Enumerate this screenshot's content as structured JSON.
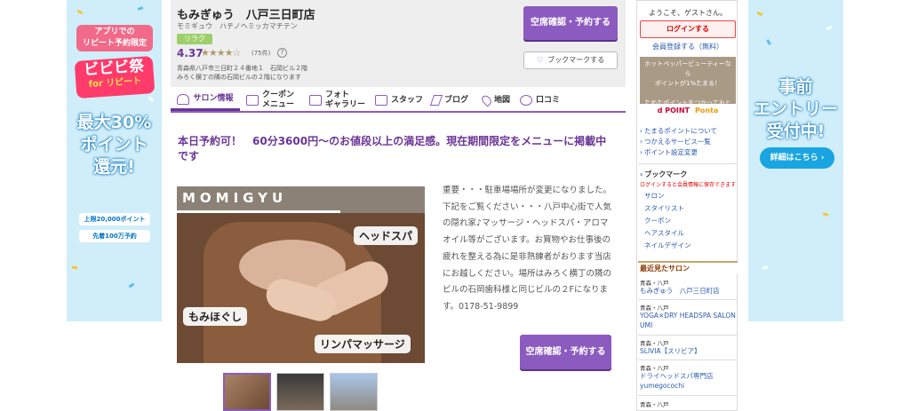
{
  "left_banner": {
    "pill": "アプリでの\nリピート予約限定",
    "logo_main": "ビビビ祭",
    "logo_sub": "for リピート",
    "headline_1": "最大30%",
    "headline_2": "ポイント",
    "headline_3": "還元!",
    "sub_1": "上限20,000ポイント",
    "sub_2": "先着100万予約"
  },
  "right_banner": {
    "headline_1": "事前",
    "headline_2": "エントリー",
    "headline_3": "受付中!",
    "button": "詳細はこちら ›"
  },
  "salon": {
    "name": "もみぎゅう　八戸三日町店",
    "kana": "モミギュウ　ハチノヘミッカマチテン",
    "category": "リラク",
    "rating": "4.37",
    "stars": "★★★★☆",
    "review_count": "(75件)",
    "help": "?",
    "address_1": "青森県八戸市三日町２４番地１　石岡ビル２階",
    "address_2": "みろく横丁の隣の石岡ビルの２階になります",
    "reserve_label": "空席確認・予約する",
    "bookmark_label": "ブックマークする"
  },
  "tabs": [
    {
      "label": "サロン情報"
    },
    {
      "label": "クーポン\nメニュー"
    },
    {
      "label": "フォト\nギャラリー"
    },
    {
      "label": "スタッフ"
    },
    {
      "label": "ブログ"
    },
    {
      "label": "地図"
    },
    {
      "label": "口コミ"
    }
  ],
  "main": {
    "catch_copy": "本日予約可！　60分3600円〜のお値段以上の満足感。現在期間限定をメニューに掲載中です",
    "photo_brand": "MOMIGYU",
    "photo_label_1": "ヘッドスパ",
    "photo_label_2": "もみほぐし",
    "photo_label_3": "リンパマッサージ",
    "description": "重要・・・駐車場場所が変更になりました。下記をご覧ください・・・八戸中心街で人気の隠れ家♪マッサージ・ヘッドスパ・アロマオイル等がございます。お買物やお仕事後の疲れを整える為に是非熟練者がおります当店にお越しください。場所はみろく横丁の隣のビルの石岡歯科様と同じビルの２Fになります。0178-51-9899",
    "reserve_label": "空席確認・予約する"
  },
  "sidebar": {
    "welcome": "ようこそ、ゲストさん。",
    "login": "ログインする",
    "register": "会員登録する（無料）",
    "points_text": "ホットペッパービューティーなら\nポイントが1%たまる！\n\nためたポイントをつかっておとくにサロンをネット予約！",
    "logo_d": "d POINT",
    "logo_p": "Ponta",
    "links": [
      "たまるポイントについて",
      "つかえるサービス一覧",
      "ポイント設定変更"
    ],
    "bookmark_title": "ブックマーク",
    "bookmark_note": "ログインすると会員情報に保存できます",
    "bookmark_items": [
      "サロン",
      "スタイリスト",
      "クーポン",
      "ヘアスタイル",
      "ネイルデザイン"
    ],
    "recent_title": "最近見たサロン",
    "recent": [
      {
        "area": "青森・八戸",
        "name": "もみぎゅう　八戸三日町店"
      },
      {
        "area": "青森・八戸",
        "name": "YOGA×DRY HEADSPA SALON UMI"
      },
      {
        "area": "青森・八戸",
        "name": "SLIVIA【スリビア】"
      },
      {
        "area": "青森・八戸",
        "name": "ドライヘッドスパ専門店 yumegocochi"
      },
      {
        "area": "青森・八戸",
        "name": ""
      }
    ]
  },
  "colors": {
    "accent_purple": "#8c5bbf",
    "banner_blue": "#cfeefa",
    "link_blue": "#2a5bb0"
  }
}
